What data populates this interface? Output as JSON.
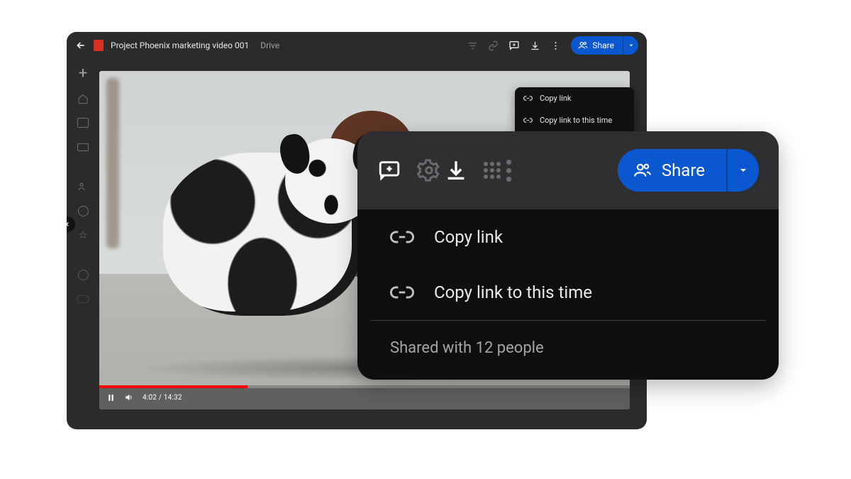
{
  "header": {
    "title": "Project Phoenix marketing video 001",
    "location": "Drive",
    "share_label": "Share"
  },
  "playback": {
    "current_time": "4:02",
    "total_time": "14:32"
  },
  "small_menu": {
    "copy_link": "Copy link",
    "copy_link_time": "Copy link to this time",
    "shared_with": "Shared with 12 people"
  },
  "overlay": {
    "share_label": "Share",
    "copy_link": "Copy link",
    "copy_link_time": "Copy link to this time",
    "shared_with": "Shared with 12 people"
  }
}
